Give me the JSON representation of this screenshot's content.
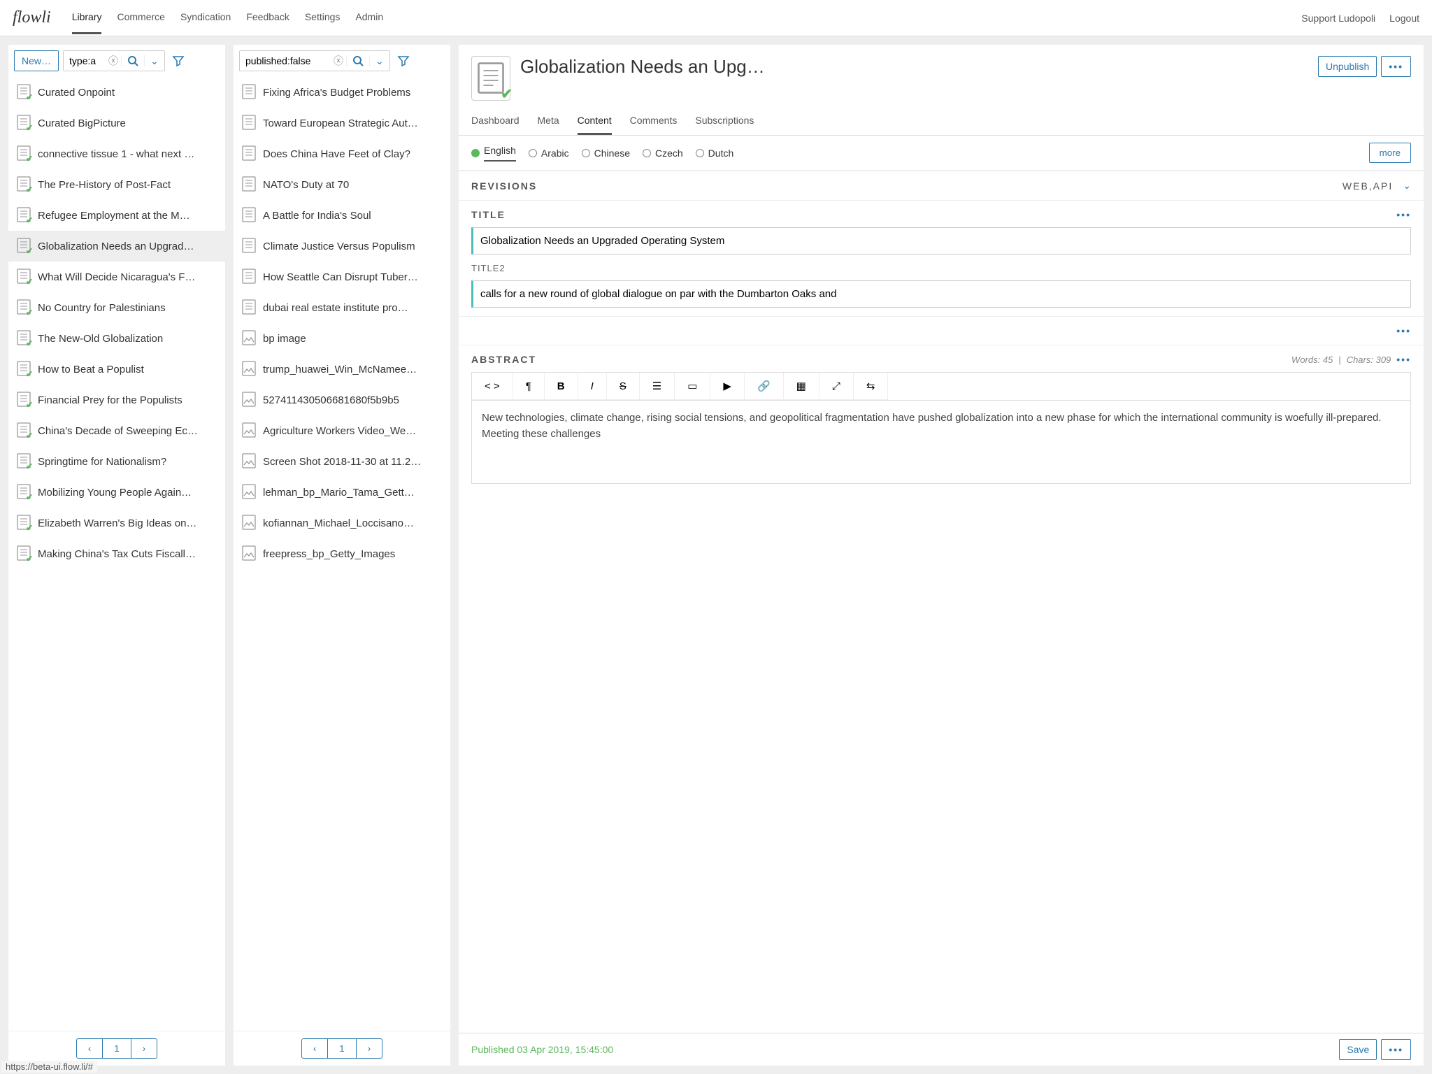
{
  "brand": "flowli",
  "nav": {
    "items": [
      "Library",
      "Commerce",
      "Syndication",
      "Feedback",
      "Settings",
      "Admin"
    ],
    "active": "Library",
    "right": [
      "Support Ludopoli",
      "Logout"
    ]
  },
  "col1": {
    "newBtn": "New…",
    "filterValue": "type:a",
    "items": [
      {
        "label": "Curated Onpoint",
        "check": true
      },
      {
        "label": "Curated BigPicture",
        "check": true
      },
      {
        "label": "connective tissue 1 - what next …",
        "check": true
      },
      {
        "label": "The Pre-History of Post-Fact",
        "check": true
      },
      {
        "label": "Refugee Employment at the M…",
        "check": true
      },
      {
        "label": "Globalization Needs an Upgrad…",
        "check": true,
        "selected": true
      },
      {
        "label": "What Will Decide Nicaragua's F…",
        "check": true
      },
      {
        "label": "No Country for Palestinians",
        "check": true
      },
      {
        "label": "The New-Old Globalization",
        "check": true
      },
      {
        "label": "How to Beat a Populist",
        "check": true
      },
      {
        "label": "Financial Prey for the Populists",
        "check": true
      },
      {
        "label": "China's Decade of Sweeping Ec…",
        "check": true
      },
      {
        "label": "Springtime for Nationalism?",
        "check": true
      },
      {
        "label": "Mobilizing Young People Again…",
        "check": true
      },
      {
        "label": "Elizabeth Warren's Big Ideas on…",
        "check": true
      },
      {
        "label": "Making China's Tax Cuts Fiscall…",
        "check": true
      }
    ],
    "page": "1"
  },
  "col2": {
    "filterValue": "published:false",
    "items": [
      {
        "label": "Fixing Africa's Budget Problems",
        "type": "doc"
      },
      {
        "label": "Toward European Strategic Aut…",
        "type": "doc"
      },
      {
        "label": "Does China Have Feet of Clay?",
        "type": "doc"
      },
      {
        "label": "NATO's Duty at 70",
        "type": "doc"
      },
      {
        "label": "A Battle for India's Soul",
        "type": "doc"
      },
      {
        "label": "Climate Justice Versus Populism",
        "type": "doc"
      },
      {
        "label": "How Seattle Can Disrupt Tuber…",
        "type": "doc"
      },
      {
        "label": "dubai real estate institute pro…",
        "type": "doc"
      },
      {
        "label": "bp image",
        "type": "img"
      },
      {
        "label": "trump_huawei_Win_McNamee…",
        "type": "img"
      },
      {
        "label": "527411430506681680f5b9b5",
        "type": "img"
      },
      {
        "label": "Agriculture Workers Video_We…",
        "type": "img"
      },
      {
        "label": "Screen Shot 2018-11-30 at 11.2…",
        "type": "img"
      },
      {
        "label": "lehman_bp_Mario_Tama_Gett…",
        "type": "img"
      },
      {
        "label": "kofiannan_Michael_Loccisano…",
        "type": "img"
      },
      {
        "label": "freepress_bp_Getty_Images",
        "type": "img"
      }
    ],
    "page": "1"
  },
  "detail": {
    "title": "Globalization Needs an Upg…",
    "unpublish": "Unpublish",
    "tabs": [
      "Dashboard",
      "Meta",
      "Content",
      "Comments",
      "Subscriptions"
    ],
    "activeTab": "Content",
    "languages": [
      "English",
      "Arabic",
      "Chinese",
      "Czech",
      "Dutch"
    ],
    "activeLang": "English",
    "moreBtn": "more",
    "revisions": {
      "label": "REVISIONS",
      "channels": "WEB,API"
    },
    "titleSection": {
      "label": "TITLE",
      "value": "Globalization Needs an Upgraded Operating System"
    },
    "title2Section": {
      "label": "TITLE2",
      "value": "calls for a new round of global dialogue on par with the Dumbarton Oaks and"
    },
    "abstract": {
      "label": "ABSTRACT",
      "words": "Words: 45",
      "chars": "Chars: 309",
      "body": "New technologies, climate change, rising social tensions, and geopolitical fragmentation have pushed globalization into a new phase for which the international community is woefully ill-prepared. Meeting these challenges"
    },
    "footer": {
      "status": "Published 03 Apr 2019, 15:45:00",
      "save": "Save"
    }
  },
  "statusUrl": "https://beta-ui.flow.li/#"
}
